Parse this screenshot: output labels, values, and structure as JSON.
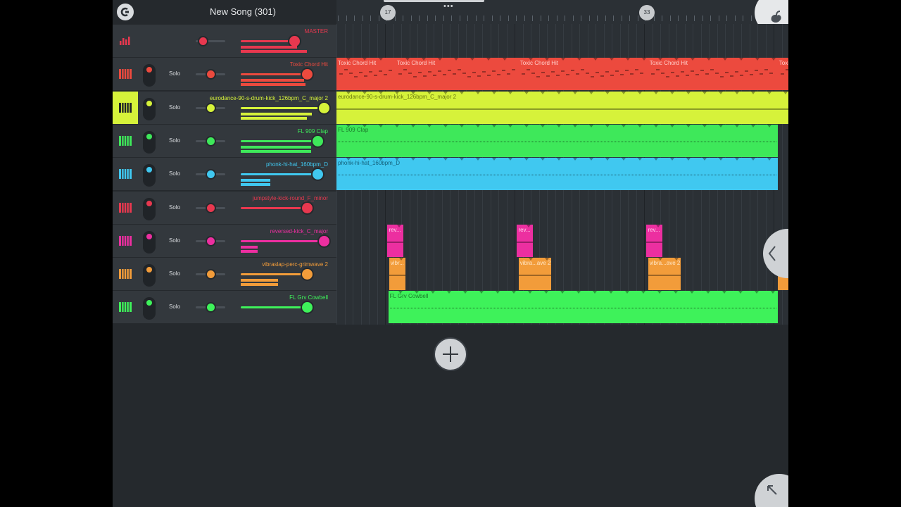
{
  "header": {
    "song_title": "New Song (301)",
    "bar_markers": [
      "17",
      "33"
    ],
    "menu_dots": "•••"
  },
  "colors": {
    "master": "#e8384f",
    "red": "#ec4a3e",
    "lime": "#d6f23a",
    "green": "#3ee85a",
    "blue": "#40c8f0",
    "crimson": "#e8384f",
    "magenta": "#ec2fa0",
    "orange": "#f29c3a",
    "bright_green": "#3ef25a"
  },
  "mixer": {
    "solo_label": "Solo",
    "tracks": [
      {
        "name": "MASTER",
        "color": "#e8384f",
        "icon": "mixer-bars-icon",
        "pan": 0.25,
        "volume": 0.65,
        "meters": [
          0.68,
          0.8
        ],
        "solo_shown": false
      },
      {
        "name": "Toxic Chord Hit",
        "color": "#ec4a3e",
        "icon": "piano-icon",
        "pan": 0.5,
        "volume": 0.8,
        "meters": [
          0.76,
          0.78
        ],
        "solo_shown": true
      },
      {
        "name": "eurodance-90-s-drum-kick_126bpm_C_major 2",
        "color": "#d6f23a",
        "icon": "piano-icon",
        "pan": 0.5,
        "volume": 1.0,
        "meters": [
          0.86,
          0.8
        ],
        "solo_shown": true
      },
      {
        "name": "FL 909 Clap",
        "color": "#3ee85a",
        "icon": "piano-icon",
        "pan": 0.5,
        "volume": 0.93,
        "meters": [
          0.85,
          0.85
        ],
        "solo_shown": true
      },
      {
        "name": "phonk-hi-hat_160bpm_D",
        "color": "#40c8f0",
        "icon": "piano-icon",
        "pan": 0.5,
        "volume": 0.93,
        "meters": [
          0.36,
          0.36
        ],
        "solo_shown": true
      },
      {
        "name": "jumpstyle-kick-round_F_minor",
        "color": "#e8384f",
        "icon": "piano-icon",
        "pan": 0.5,
        "volume": 0.8,
        "meters": [],
        "solo_shown": true
      },
      {
        "name": "reversed-kick_C_major",
        "color": "#ec2fa0",
        "icon": "piano-icon",
        "pan": 0.5,
        "volume": 1.0,
        "meters": [
          0.2,
          0.2
        ],
        "solo_shown": true
      },
      {
        "name": "vibraslap-perc-grimwave 2",
        "color": "#f29c3a",
        "icon": "piano-icon",
        "pan": 0.5,
        "volume": 0.8,
        "meters": [
          0.45,
          0.45
        ],
        "solo_shown": true
      },
      {
        "name": "FL Grv Cowbell",
        "color": "#3ef25a",
        "icon": "piano-icon",
        "pan": 0.5,
        "volume": 0.8,
        "meters": [],
        "solo_shown": true
      }
    ]
  },
  "playlist": {
    "clips": [
      {
        "track": 1,
        "label": "Toxic Chord Hit",
        "start": 0,
        "end": 7.3,
        "color": "#ec4a3e",
        "text_color": "#ffd0cc",
        "style": "pattern"
      },
      {
        "track": 1,
        "label": "Toxic Chord Hit",
        "start": 7.3,
        "end": 22.5,
        "color": "#ec4a3e",
        "text_color": "#ffd0cc",
        "style": "pattern"
      },
      {
        "track": 1,
        "label": "Toxic Chord Hit",
        "start": 22.5,
        "end": 38.5,
        "color": "#ec4a3e",
        "text_color": "#ffd0cc",
        "style": "pattern"
      },
      {
        "track": 1,
        "label": "Toxic Chord Hit",
        "start": 38.5,
        "end": 54.5,
        "color": "#ec4a3e",
        "text_color": "#ffd0cc",
        "style": "pattern"
      },
      {
        "track": 1,
        "label": "Toxi",
        "start": 54.5,
        "end": 56.5,
        "color": "#ec4a3e",
        "text_color": "#ffd0cc",
        "style": "pattern"
      },
      {
        "track": 2,
        "label": "eurodance-90-s-drum-kick_126bpm_C_major 2",
        "start": 0,
        "end": 56.5,
        "color": "#d6f23a",
        "text_color": "#6b7a10",
        "style": "line"
      },
      {
        "track": 3,
        "label": "FL 909 Clap",
        "start": 0,
        "end": 54.5,
        "color": "#3ee85a",
        "text_color": "#1c7a2c",
        "style": "dots"
      },
      {
        "track": 4,
        "label": "phonk-hi-hat_160bpm_D",
        "start": 0,
        "end": 54.5,
        "color": "#40c8f0",
        "text_color": "#14607a",
        "style": "dots"
      },
      {
        "track": 6,
        "label": "rev...",
        "start": 6.3,
        "end": 8.3,
        "color": "#ec2fa0",
        "text_color": "#ffd0ec",
        "style": "line"
      },
      {
        "track": 6,
        "label": "rev...",
        "start": 22.3,
        "end": 24.3,
        "color": "#ec2fa0",
        "text_color": "#ffd0ec",
        "style": "line"
      },
      {
        "track": 6,
        "label": "rev...",
        "start": 38.3,
        "end": 40.3,
        "color": "#ec2fa0",
        "text_color": "#ffd0ec",
        "style": "line"
      },
      {
        "track": 7,
        "label": "vibr...",
        "start": 6.5,
        "end": 8.5,
        "color": "#f29c3a",
        "text_color": "#ffe7c8",
        "style": "line"
      },
      {
        "track": 7,
        "label": "vibra...ave 2",
        "start": 22.5,
        "end": 26.5,
        "color": "#f29c3a",
        "text_color": "#ffe7c8",
        "style": "line"
      },
      {
        "track": 7,
        "label": "vibra...ave 2",
        "start": 38.5,
        "end": 42.5,
        "color": "#f29c3a",
        "text_color": "#ffe7c8",
        "style": "line"
      },
      {
        "track": 7,
        "label": "",
        "start": 54.5,
        "end": 56.5,
        "color": "#f29c3a",
        "text_color": "#ffe7c8",
        "style": "line"
      },
      {
        "track": 8,
        "label": "FL Grv Cowbell",
        "start": 6.4,
        "end": 54.5,
        "color": "#3ef25a",
        "text_color": "#1c7a2c",
        "style": "dots"
      }
    ]
  },
  "buttons": {
    "add_track_icon": "plus-icon",
    "back_icon": "fl-back-icon",
    "logo_icon": "fl-fruit-logo-icon",
    "collapse_icon": "chevron-left-icon",
    "resize_icon": "arrow-up-left-icon"
  }
}
